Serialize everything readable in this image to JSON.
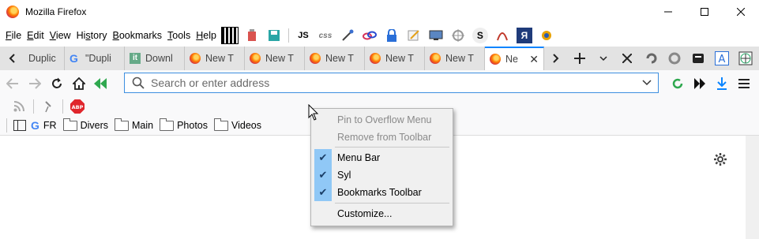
{
  "window": {
    "title": "Mozilla Firefox"
  },
  "menubar": {
    "items": [
      {
        "pre": "",
        "u": "F",
        "post": "ile"
      },
      {
        "pre": "",
        "u": "E",
        "post": "dit"
      },
      {
        "pre": "",
        "u": "V",
        "post": "iew"
      },
      {
        "pre": "Hi",
        "u": "s",
        "post": "tory"
      },
      {
        "pre": "",
        "u": "B",
        "post": "ookmarks"
      },
      {
        "pre": "",
        "u": "T",
        "post": "ools"
      },
      {
        "pre": "",
        "u": "H",
        "post": "elp"
      }
    ],
    "icon_labels": {
      "js": "JS",
      "css": "css",
      "s": "S",
      "ya": "Я"
    }
  },
  "tabs": [
    {
      "label": "Duplic"
    },
    {
      "label": "\"Dupli"
    },
    {
      "label": "Downl"
    },
    {
      "label": "New T"
    },
    {
      "label": "New T"
    },
    {
      "label": "New T"
    },
    {
      "label": "New T"
    },
    {
      "label": "New T"
    },
    {
      "label": "Ne"
    }
  ],
  "urlbar": {
    "placeholder": "Search or enter address"
  },
  "syl_toolbar": {
    "abp_label": "ABP"
  },
  "bookmarks": {
    "items": [
      {
        "label": "FR"
      },
      {
        "label": "Divers"
      },
      {
        "label": "Main"
      },
      {
        "label": "Photos"
      },
      {
        "label": "Videos"
      }
    ]
  },
  "context_menu": {
    "pin": "Pin to Overflow Menu",
    "remove": "Remove from Toolbar",
    "menu_bar": "Menu Bar",
    "syl": "Syl",
    "bookmarks_toolbar": "Bookmarks Toolbar",
    "customize": "Customize..."
  },
  "colors": {
    "accent": "#0a84ff",
    "check_bg": "#90c8f6",
    "menu_bg": "#f0f0f0"
  }
}
